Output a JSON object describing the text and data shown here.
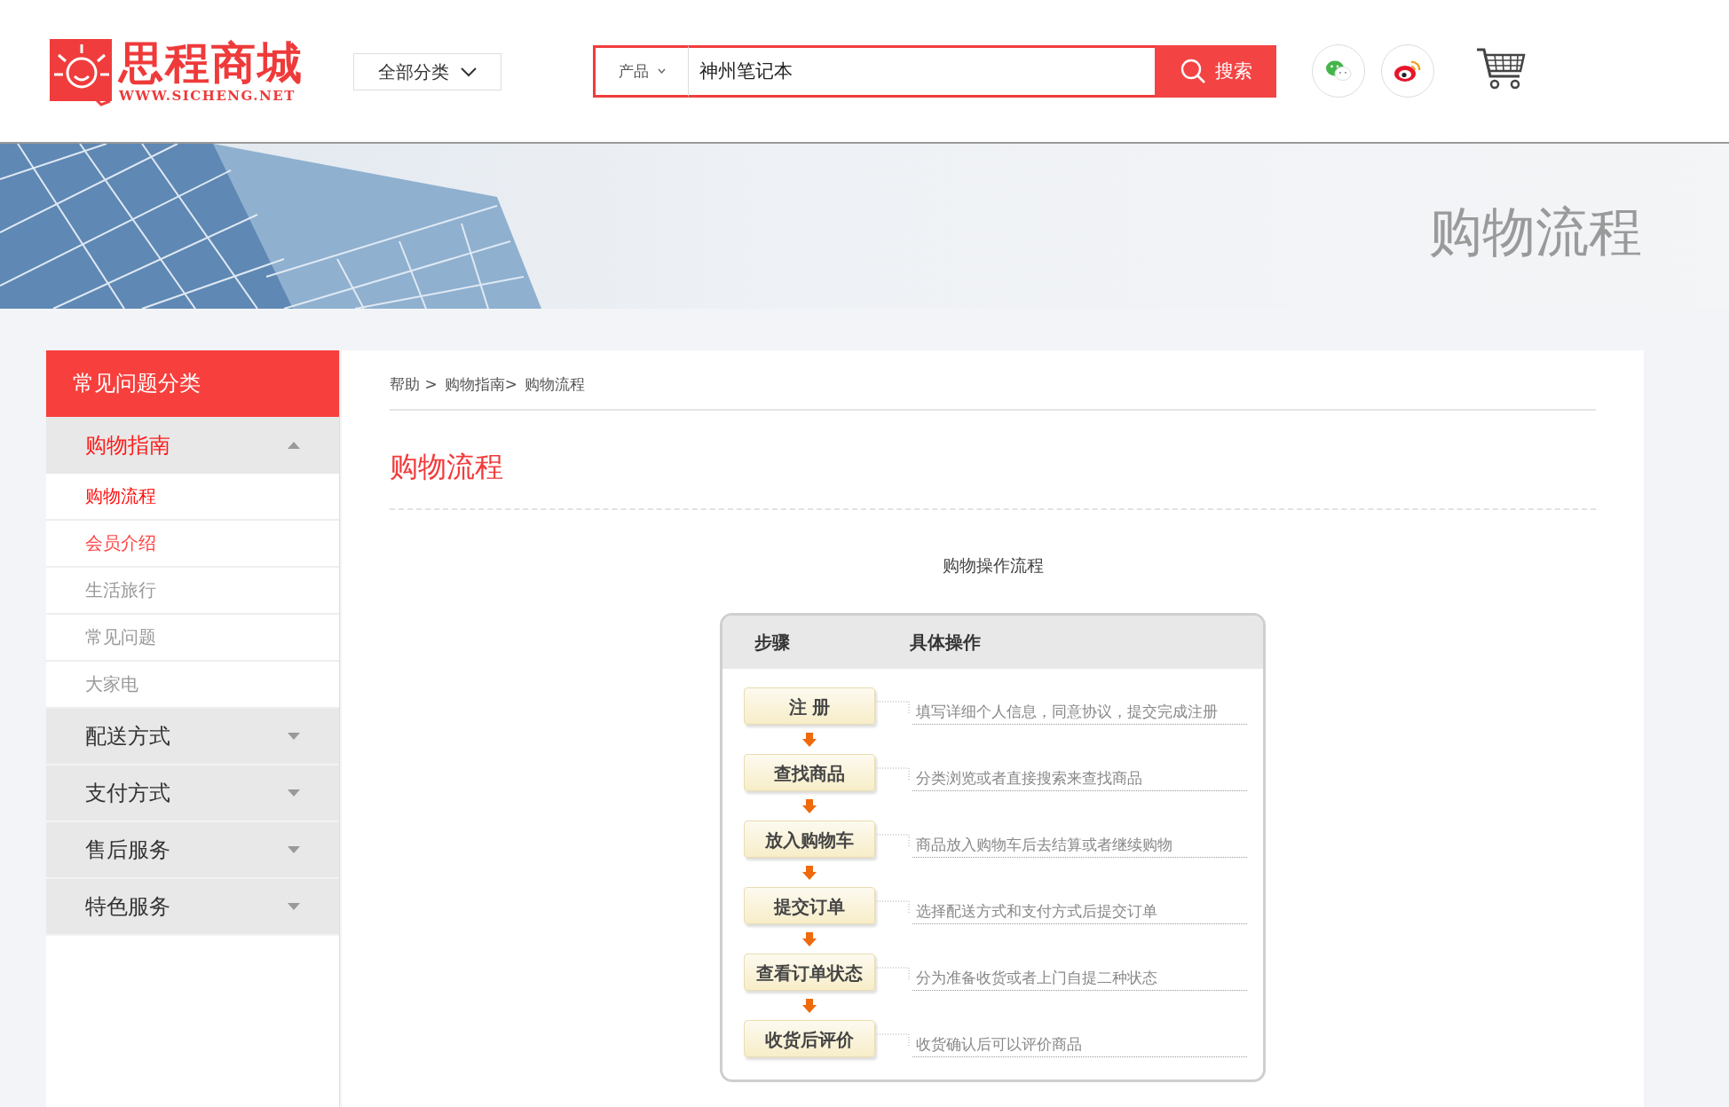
{
  "header": {
    "logo": {
      "title": "思程商城",
      "subtitle": "WWW.SICHENG.NET"
    },
    "category_dropdown": "全部分类",
    "search": {
      "scope": "产品",
      "value": "神州笔记本",
      "button": "搜索"
    }
  },
  "banner": {
    "title": "购物流程"
  },
  "sidebar": {
    "title": "常见问题分类",
    "groups": [
      {
        "label": "购物指南",
        "expanded": true,
        "children": [
          {
            "label": "购物流程",
            "selected": true,
            "hovered": false
          },
          {
            "label": "会员介绍",
            "selected": false,
            "hovered": true
          },
          {
            "label": "生活旅行",
            "selected": false,
            "hovered": false
          },
          {
            "label": "常见问题",
            "selected": false,
            "hovered": false
          },
          {
            "label": "大家电",
            "selected": false,
            "hovered": false
          }
        ]
      },
      {
        "label": "配送方式",
        "expanded": false
      },
      {
        "label": "支付方式",
        "expanded": false
      },
      {
        "label": "售后服务",
        "expanded": false
      },
      {
        "label": "特色服务",
        "expanded": false
      }
    ]
  },
  "content": {
    "breadcrumb": [
      "帮助 >",
      "购物指南>",
      "购物流程"
    ],
    "title": "购物流程",
    "caption": "购物操作流程",
    "flow": {
      "columns": [
        "步骤",
        "具体操作"
      ],
      "steps": [
        {
          "label": "注 册",
          "description": "填写详细个人信息，同意协议，提交完成注册"
        },
        {
          "label": "查找商品",
          "description": "分类浏览或者直接搜索来查找商品"
        },
        {
          "label": "放入购物车",
          "description": "商品放入购物车后去结算或者继续购物"
        },
        {
          "label": "提交订单",
          "description": "选择配送方式和支付方式后提交订单"
        },
        {
          "label": "查看订单状态",
          "description": "分为准备收货或者上门自提二种状态"
        },
        {
          "label": "收货后评价",
          "description": "收货确认后可以评价商品"
        }
      ]
    }
  }
}
